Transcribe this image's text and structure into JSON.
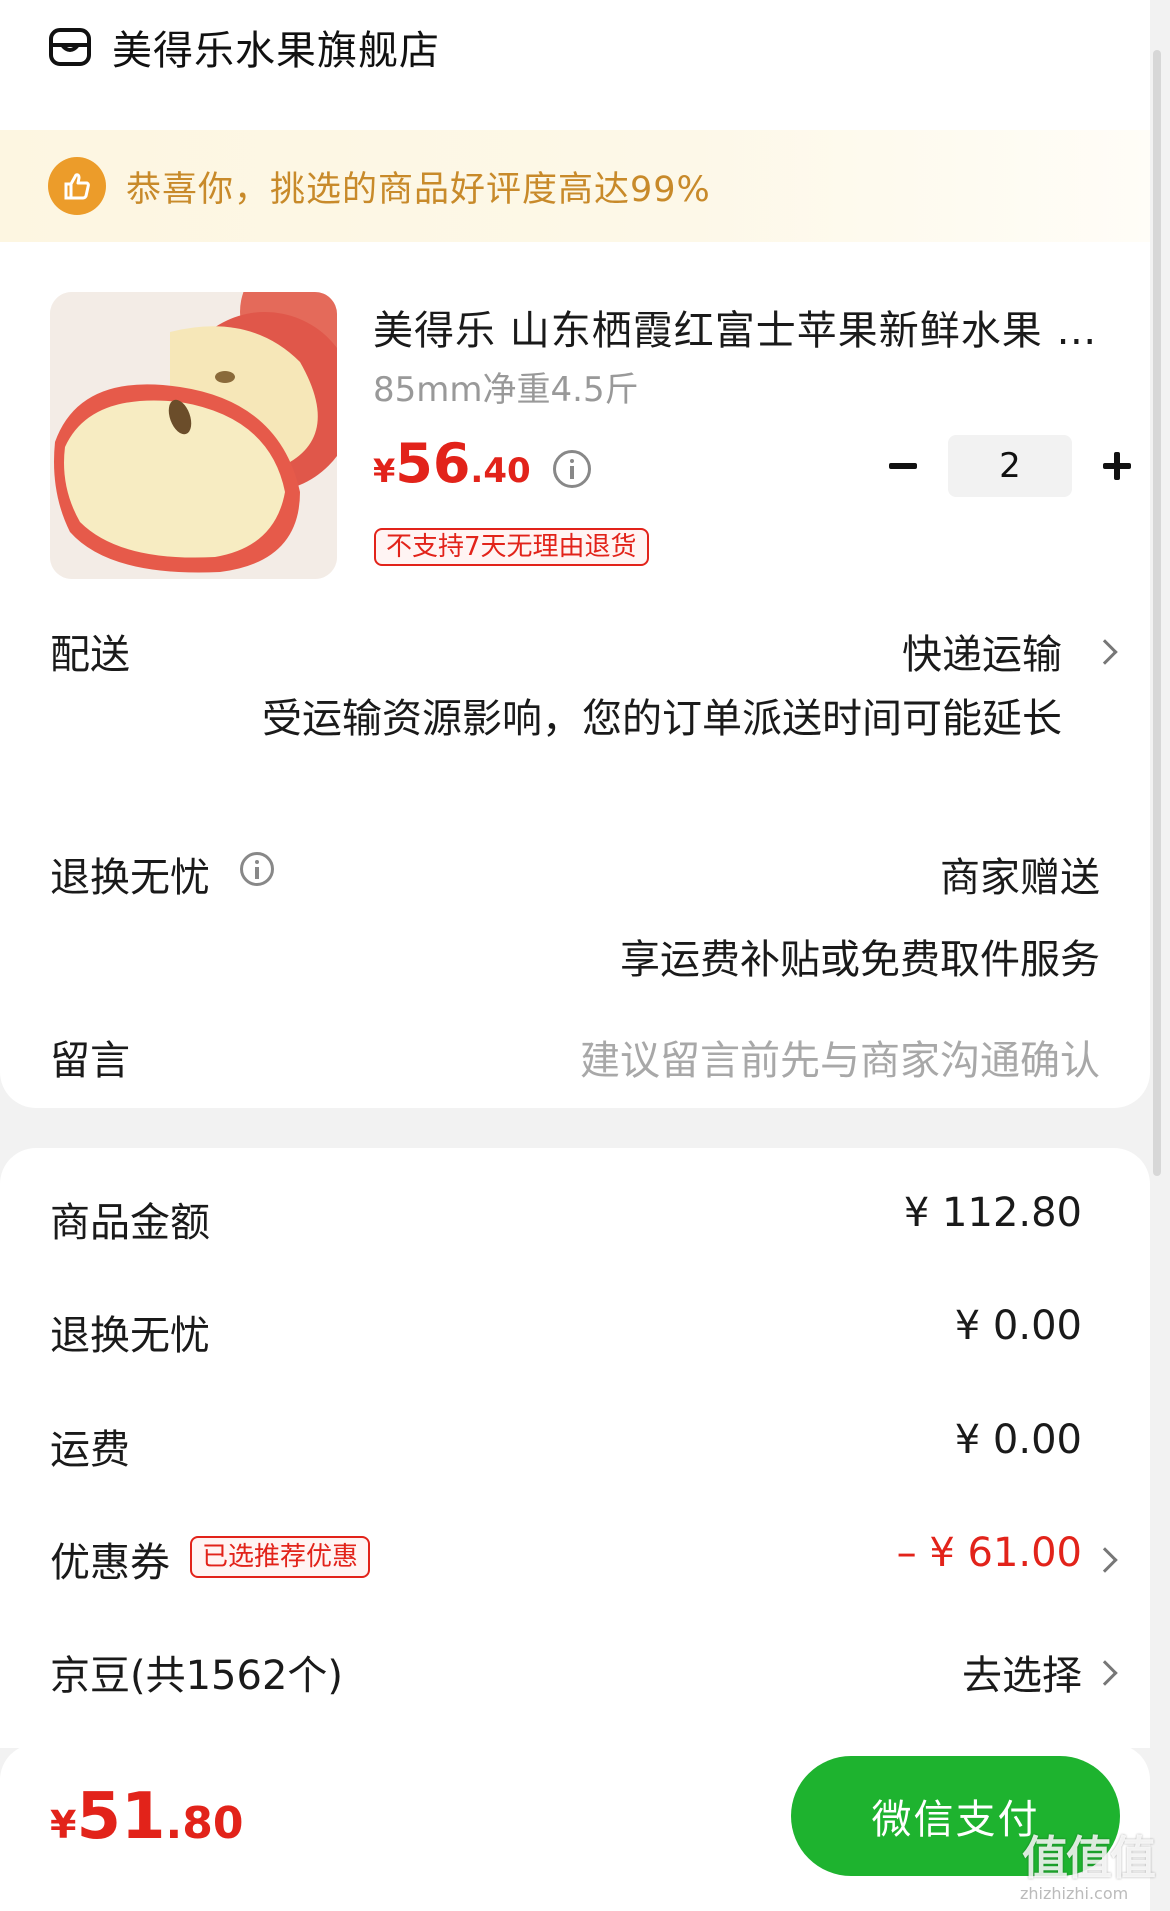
{
  "store": {
    "name": "美得乐水果旗舰店",
    "icon": "store-icon"
  },
  "banner": {
    "text": "恭喜你，挑选的商品好评度高达99%",
    "icon": "thumbs-up-icon"
  },
  "product": {
    "title": "美得乐 山东栖霞红富士苹果新鲜水果 …",
    "spec": "85mm净重4.5斤",
    "price": {
      "currency": "¥",
      "integer": "56",
      "decimal": ".40"
    },
    "quantity": "2",
    "no_return_tag": "不支持7天无理由退货"
  },
  "delivery": {
    "label": "配送",
    "value": "快递运输",
    "note": "受运输资源影响，您的订单派送时间可能延长"
  },
  "worry_free": {
    "label": "退换无忧",
    "value": "商家赠送",
    "note": "享运费补贴或免费取件服务"
  },
  "message": {
    "label": "留言",
    "placeholder": "建议留言前先与商家沟通确认"
  },
  "summary": {
    "goods_amount": {
      "label": "商品金额",
      "value": "¥ 112.80"
    },
    "worry_free": {
      "label": "退换无忧",
      "value": "¥ 0.00"
    },
    "shipping": {
      "label": "运费",
      "value": "¥ 0.00"
    },
    "coupon": {
      "label": "优惠券",
      "tag": "已选推荐优惠",
      "value": "– ¥ 61.00"
    },
    "jingdou": {
      "label": "京豆(共1562个)",
      "value": "去选择"
    }
  },
  "footer": {
    "total": {
      "currency": "¥",
      "integer": "51",
      "decimal": ".80"
    },
    "pay_button": "微信支付",
    "watermark": "值值值",
    "watermark_url": "zhizhizhi.com"
  },
  "colors": {
    "price_red": "#e2231a",
    "pay_green": "#1eb32f",
    "banner_text": "#c88a2a",
    "banner_icon": "#ec9c2a"
  }
}
